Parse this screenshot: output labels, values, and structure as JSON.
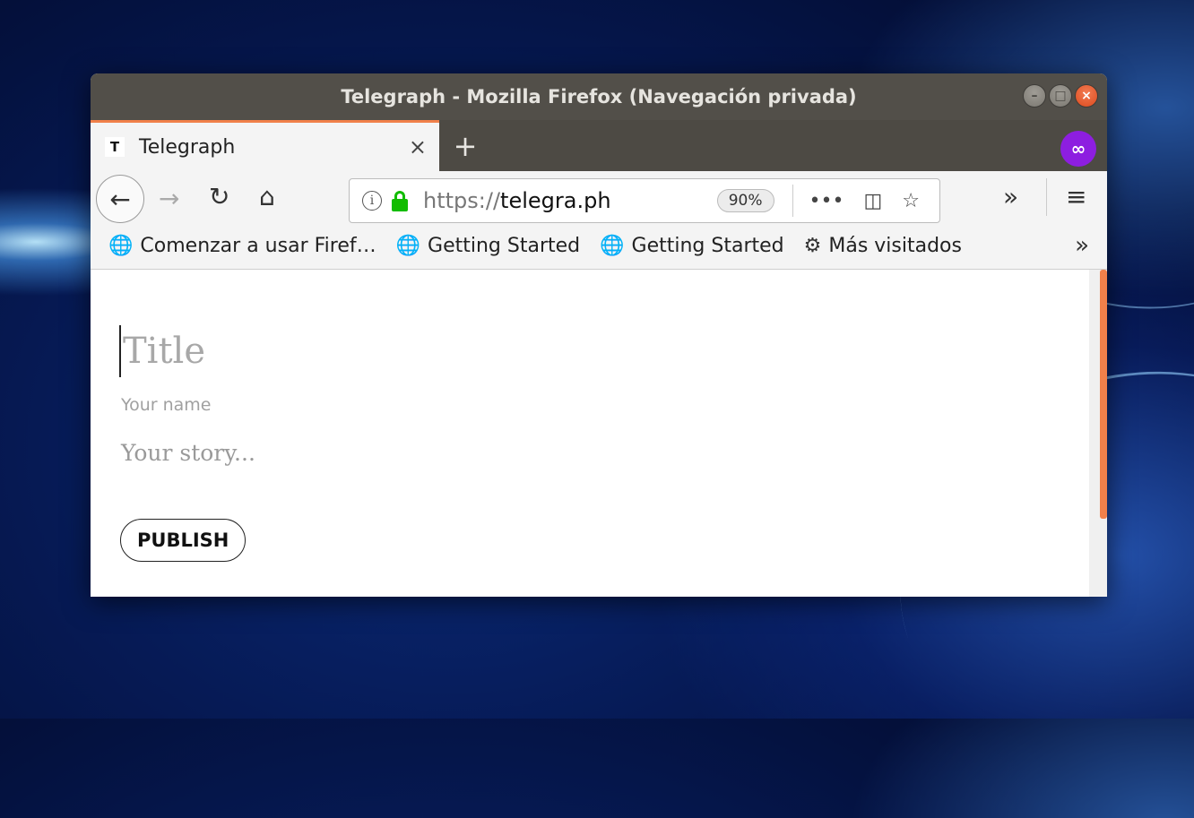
{
  "window": {
    "title": "Telegraph - Mozilla Firefox (Navegación privada)"
  },
  "tab": {
    "favicon": "T",
    "title": "Telegraph",
    "close": "×",
    "new_tab": "+"
  },
  "navbar": {
    "back": "←",
    "forward": "→",
    "reload": "↻",
    "home": "⌂",
    "url_scheme": "https://",
    "url_host": "telegra.ph",
    "zoom": "90%",
    "page_actions": "•••",
    "pocket": "◫",
    "bookmark_star": "☆",
    "overflow": "»",
    "menu": "≡"
  },
  "bookmarks": {
    "items": [
      {
        "icon": "🌐",
        "label": "Comenzar a usar Firef…"
      },
      {
        "icon": "🌐",
        "label": "Getting Started"
      },
      {
        "icon": "🌐",
        "label": "Getting Started"
      },
      {
        "icon": "⚙",
        "label": "Más visitados"
      }
    ],
    "overflow": "»"
  },
  "editor": {
    "title_placeholder": "Title",
    "name_placeholder": "Your name",
    "story_placeholder": "Your story...",
    "publish_label": "PUBLISH"
  },
  "colors": {
    "accent": "#f0804a",
    "private": "#8d1ee0",
    "lock": "#12bc00",
    "titlebar": "#524f49"
  },
  "icons": [
    "back-arrow-icon",
    "forward-arrow-icon",
    "reload-icon",
    "home-icon",
    "info-icon",
    "lock-icon",
    "pocket-icon",
    "star-icon",
    "hamburger-menu-icon",
    "globe-icon",
    "gear-icon",
    "private-mask-icon"
  ]
}
